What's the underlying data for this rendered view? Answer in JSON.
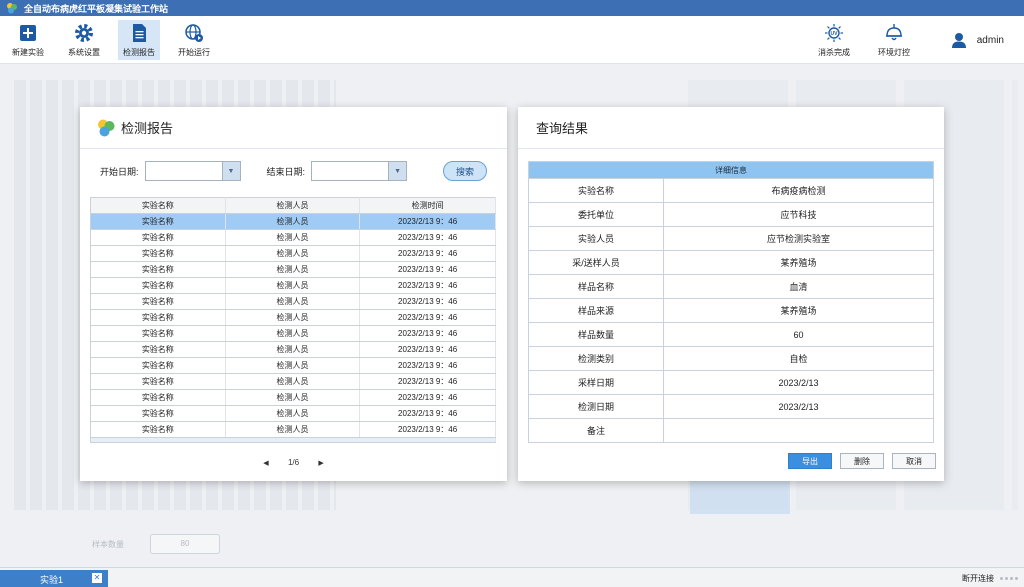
{
  "app": {
    "title": "全自动布病虎红平板凝集试验工作站"
  },
  "toolbar": {
    "items": [
      {
        "label": "新建实验",
        "icon": "plus-square-icon"
      },
      {
        "label": "系统设置",
        "icon": "gear-icon"
      },
      {
        "label": "检测报告",
        "icon": "document-icon",
        "active": true
      },
      {
        "label": "开始运行",
        "icon": "globe-icon"
      }
    ],
    "right_items": [
      {
        "label": "消杀完成",
        "icon": "uv-icon"
      },
      {
        "label": "环境灯控",
        "icon": "lamp-icon"
      }
    ],
    "user": "admin"
  },
  "background": {
    "sample_count_label": "样本数量",
    "sample_count_value": "80"
  },
  "report_panel": {
    "title": "检测报告",
    "start_date_label": "开始日期:",
    "end_date_label": "结束日期:",
    "search_label": "搜索",
    "columns": [
      "实验名称",
      "检测人员",
      "检测时间"
    ],
    "rows": [
      [
        "实验名称",
        "检测人员",
        "2023/2/13  9：46"
      ],
      [
        "实验名称",
        "检测人员",
        "2023/2/13  9：46"
      ],
      [
        "实验名称",
        "检测人员",
        "2023/2/13  9：46"
      ],
      [
        "实验名称",
        "检测人员",
        "2023/2/13  9：46"
      ],
      [
        "实验名称",
        "检测人员",
        "2023/2/13  9：46"
      ],
      [
        "实验名称",
        "检测人员",
        "2023/2/13  9：46"
      ],
      [
        "实验名称",
        "检测人员",
        "2023/2/13  9：46"
      ],
      [
        "实验名称",
        "检测人员",
        "2023/2/13  9：46"
      ],
      [
        "实验名称",
        "检测人员",
        "2023/2/13  9：46"
      ],
      [
        "实验名称",
        "检测人员",
        "2023/2/13  9：46"
      ],
      [
        "实验名称",
        "检测人员",
        "2023/2/13  9：46"
      ],
      [
        "实验名称",
        "检测人员",
        "2023/2/13  9：46"
      ],
      [
        "实验名称",
        "检测人员",
        "2023/2/13  9：46"
      ],
      [
        "实验名称",
        "检测人员",
        "2023/2/13  9：46"
      ]
    ],
    "selected_row": 0,
    "pager": "1/6"
  },
  "result_panel": {
    "title": "查询结果",
    "header": "详细信息",
    "fields": [
      {
        "key": "实验名称",
        "value": "布病疫病检测"
      },
      {
        "key": "委托单位",
        "value": "应节科技"
      },
      {
        "key": "实验人员",
        "value": "应节检测实验室"
      },
      {
        "key": "采/送样人员",
        "value": "某养殖场"
      },
      {
        "key": "样品名称",
        "value": "血清"
      },
      {
        "key": "样品来源",
        "value": "某养殖场"
      },
      {
        "key": "样品数量",
        "value": "60"
      },
      {
        "key": "检测类别",
        "value": "自检"
      },
      {
        "key": "采样日期",
        "value": "2023/2/13"
      },
      {
        "key": "检测日期",
        "value": "2023/2/13"
      },
      {
        "key": "备注",
        "value": ""
      }
    ],
    "export_label": "导出",
    "delete_label": "删除",
    "cancel_label": "取消"
  },
  "statusbar": {
    "tab_label": "实验1",
    "connection": "断开连接"
  },
  "colors": {
    "titlebar": "#3c6fb4",
    "accent": "#3b8fe0",
    "selected_row": "#9fcbf5",
    "detail_header": "#8ec4f1"
  }
}
